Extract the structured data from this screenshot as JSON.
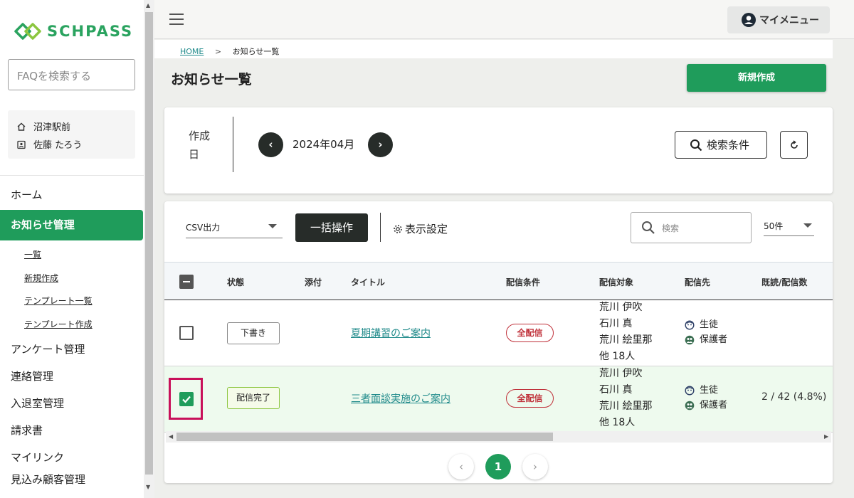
{
  "brand": {
    "logo_text": "SCHPASS",
    "color": "#2aa35f"
  },
  "sidebar": {
    "faq_placeholder": "FAQを検索する",
    "school": "沼津駅前",
    "user": "佐藤 たろう",
    "menu": [
      {
        "label": "ホーム"
      },
      {
        "label": "お知らせ管理",
        "active": true
      }
    ],
    "submenu": [
      "一覧",
      "新規作成",
      "テンプレート一覧",
      "テンプレート作成"
    ],
    "menu_rest": [
      "アンケート管理",
      "連絡管理",
      "入退室管理",
      "請求書",
      "マイリンク",
      "見込み顧客管理"
    ]
  },
  "header": {
    "mymenu_label": "マイメニュー"
  },
  "breadcrumb": {
    "home": "HOME",
    "separator": ">",
    "current": "お知らせ一覧"
  },
  "page": {
    "title": "お知らせ一覧",
    "new_button": "新規作成",
    "accent": "#1f9c5b"
  },
  "date_filter": {
    "label_line1": "作成",
    "label_line2": "日",
    "value": "2024年04月",
    "prev": "‹",
    "next": "›",
    "search_conditions": "検索条件"
  },
  "toolbar": {
    "csv": "CSV出力",
    "bulk": "一括操作",
    "display_settings": "表示設定",
    "search_placeholder": "検索",
    "per_page": "50件"
  },
  "table": {
    "headers": {
      "status": "状態",
      "attachment": "添付",
      "title": "タイトル",
      "condition": "配信条件",
      "target": "配信対象",
      "destination": "配信先",
      "read_count": "既読/配信数"
    },
    "rows": [
      {
        "checked": false,
        "status": "下書き",
        "title": "夏期講習のご案内",
        "condition": "全配信",
        "targets": [
          "荒川 伊吹",
          "石川 真",
          "荒川 絵里那",
          "他  18人"
        ],
        "destinations": [
          "生徒",
          "保護者"
        ],
        "read_count": ""
      },
      {
        "checked": true,
        "status": "配信完了",
        "title": "三者面談実施のご案内",
        "condition": "全配信",
        "targets": [
          "荒川 伊吹",
          "石川 真",
          "荒川 絵里那",
          "他  18人"
        ],
        "destinations": [
          "生徒",
          "保護者"
        ],
        "read_count": "2 / 42 (4.8%)"
      }
    ]
  },
  "pagination": {
    "prev": "‹",
    "current": "1",
    "next": "›"
  }
}
